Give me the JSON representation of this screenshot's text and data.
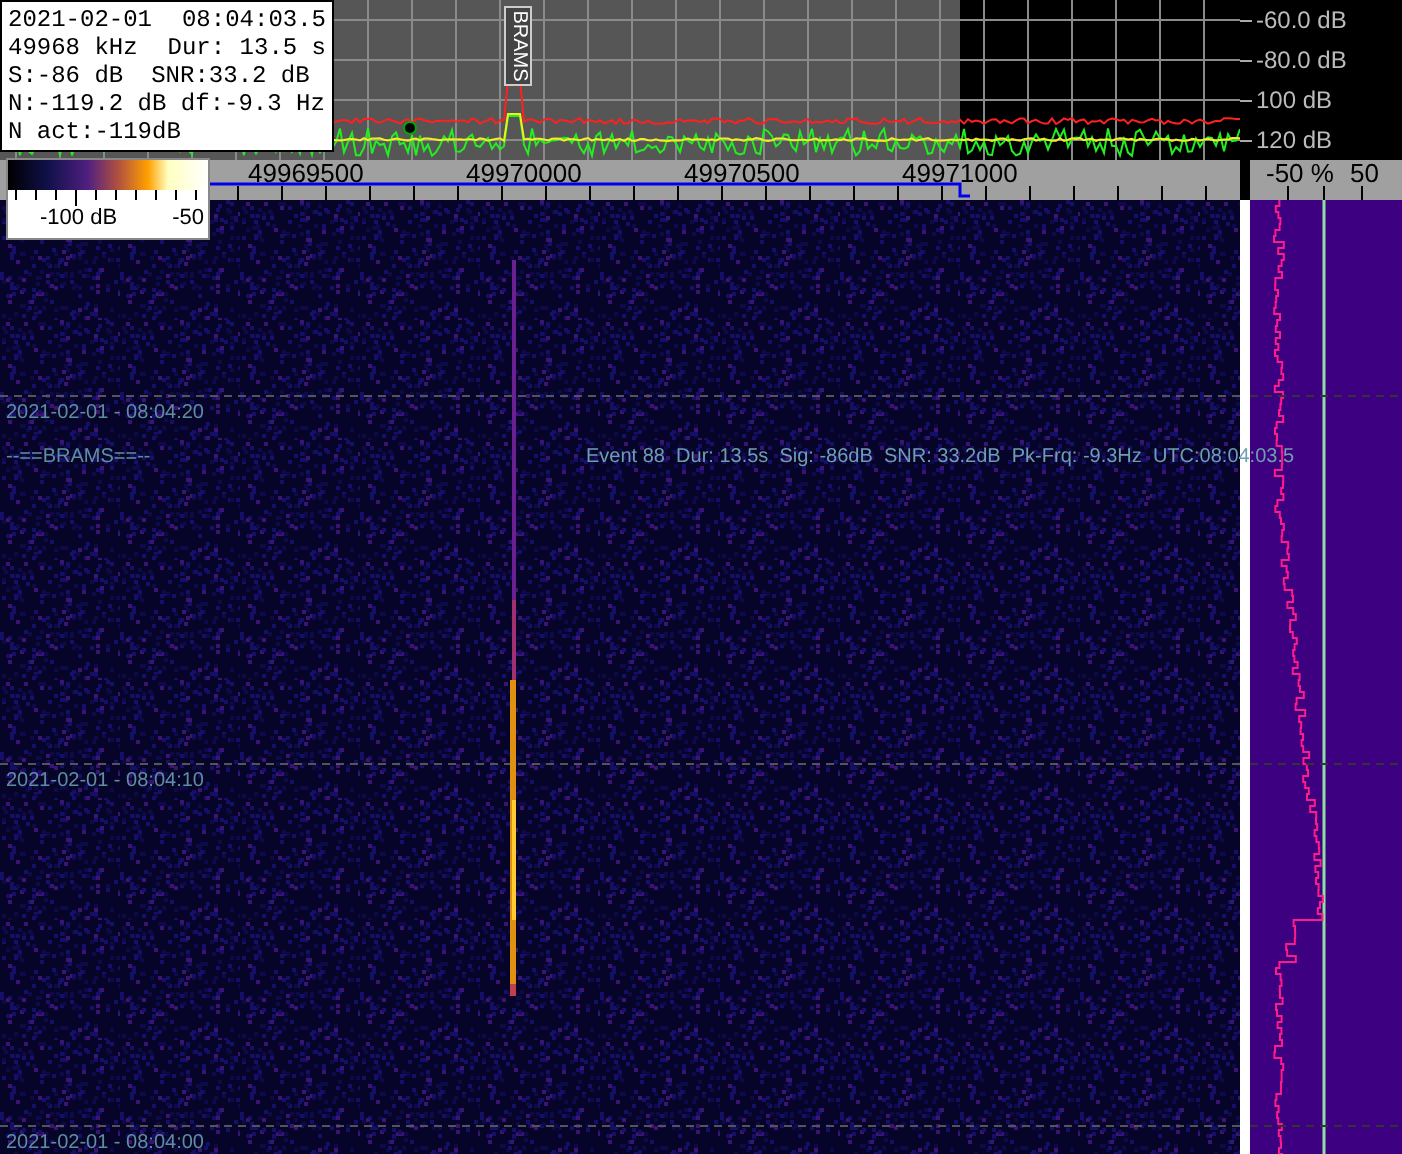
{
  "info_box": {
    "date": "2021-02-01",
    "time": "08:04:03.5",
    "frequency": "49968 kHz",
    "duration": "Dur: 13.5 s",
    "signal": "S:-86 dB",
    "snr": "SNR:33.2 dB",
    "noise": "N:-119.2 dB df:-9.3 Hz",
    "noise_actual": "N act:-119dB"
  },
  "spectrum": {
    "marker_label": "BRAMS",
    "db_labels": [
      "-60.0 dB",
      "-80.0 dB",
      "100 dB",
      "120 dB"
    ]
  },
  "frequency_axis": {
    "labels": [
      "49969500",
      "49970000",
      "49970500",
      "49971000"
    ]
  },
  "color_scale": {
    "labels": [
      "-100 dB",
      "-50"
    ]
  },
  "profile_axis": {
    "labels": [
      "-50 %",
      "50"
    ]
  },
  "waterfall": {
    "time_labels": [
      "2021-02-01 - 08:04:20",
      "2021-02-01 - 08:04:10",
      "2021-02-01 - 08:04:00"
    ],
    "station_label": "--==BRAMS==--",
    "event_text": "Event 88  Dur: 13.5s  Sig: -86dB  SNR: 33.2dB  Pk-Frq: -9.3Hz  UTC:08:04:03.5"
  }
}
